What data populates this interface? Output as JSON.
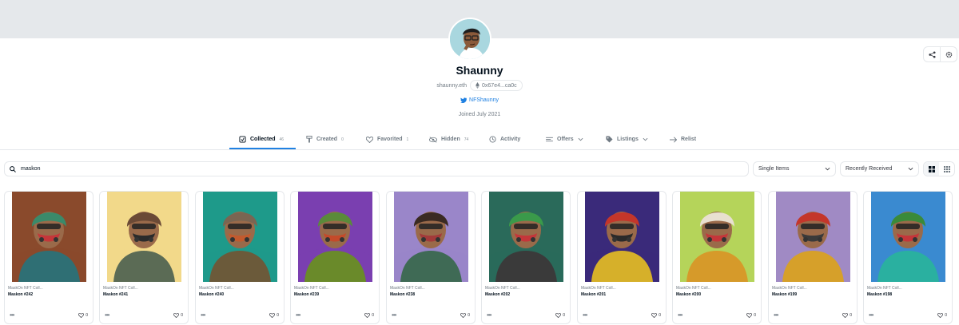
{
  "profile": {
    "username": "Shaunny",
    "ens": "shaunny.eth",
    "address": "0x67e4...ca0c",
    "twitter": "NFShaunny",
    "joined": "Joined July 2021"
  },
  "tabs": [
    {
      "label": "Collected",
      "count": "46",
      "icon": "collected-icon"
    },
    {
      "label": "Created",
      "count": "0",
      "icon": "paint-brush-icon"
    },
    {
      "label": "Favorited",
      "count": "1",
      "icon": "heart-icon"
    },
    {
      "label": "Hidden",
      "count": "74",
      "icon": "eye-off-icon"
    },
    {
      "label": "Activity",
      "count": "",
      "icon": "history-icon"
    },
    {
      "label": "Offers",
      "count": "",
      "icon": "offers-icon"
    },
    {
      "label": "Listings",
      "count": "",
      "icon": "tag-icon"
    },
    {
      "label": "Relist",
      "count": "",
      "icon": "relist-icon"
    }
  ],
  "filters": {
    "search_value": "maskon",
    "item_type": "Single Items",
    "sort": "Recently Received"
  },
  "colors": {
    "accent": "#2081e2",
    "banner": "#e5e8eb",
    "text": "#04111d",
    "muted": "#707a83"
  },
  "items": [
    {
      "collection": "MaskOn NFT Coll...",
      "name": "Maskon #242",
      "likes": "0",
      "bg": "#8a4a2c",
      "helmet": "#3a8a6a",
      "mask": "#c4363a",
      "jacket": "#2f6f74"
    },
    {
      "collection": "MaskOn NFT Coll...",
      "name": "Maskon #241",
      "likes": "0",
      "bg": "#f2d98a",
      "helmet": "#6b4a36",
      "mask": "#2b2b2b",
      "jacket": "#5b6b55"
    },
    {
      "collection": "MaskOn NFT Coll...",
      "name": "Maskon #240",
      "likes": "0",
      "bg": "#1e9a8a",
      "helmet": "#7a6552",
      "mask": "#c25a2e",
      "jacket": "#6b5a3a"
    },
    {
      "collection": "MaskOn NFT Coll...",
      "name": "Maskon #239",
      "likes": "0",
      "bg": "#7a3fb0",
      "helmet": "#5a8a3a",
      "mask": "#c44a2a",
      "jacket": "#6a8a2a"
    },
    {
      "collection": "MaskOn NFT Coll...",
      "name": "Maskon #238",
      "likes": "0",
      "bg": "#9a86c9",
      "helmet": "#3a2a22",
      "mask": "#a33a3a",
      "jacket": "#3f6a55"
    },
    {
      "collection": "MaskOn NFT Coll...",
      "name": "Maskon #202",
      "likes": "0",
      "bg": "#2a6a5a",
      "helmet": "#3a9a4a",
      "mask": "#c4363a",
      "jacket": "#3a3a3a"
    },
    {
      "collection": "MaskOn NFT Coll...",
      "name": "Maskon #201",
      "likes": "0",
      "bg": "#3a2a7a",
      "helmet": "#c4362a",
      "mask": "#2a2a2a",
      "jacket": "#d6b02a"
    },
    {
      "collection": "MaskOn NFT Coll...",
      "name": "Maskon #200",
      "likes": "0",
      "bg": "#b5d45a",
      "helmet": "#e8e0d0",
      "mask": "#c4363a",
      "jacket": "#d69a2a"
    },
    {
      "collection": "MaskOn NFT Coll...",
      "name": "Maskon #199",
      "likes": "0",
      "bg": "#a08ac4",
      "helmet": "#c4362a",
      "mask": "#3a3a3a",
      "jacket": "#d6a02a"
    },
    {
      "collection": "MaskOn NFT Coll...",
      "name": "Maskon #198",
      "likes": "0",
      "bg": "#3a8ad0",
      "helmet": "#3a8a3a",
      "mask": "#c4363a",
      "jacket": "#2ab0a0"
    }
  ]
}
